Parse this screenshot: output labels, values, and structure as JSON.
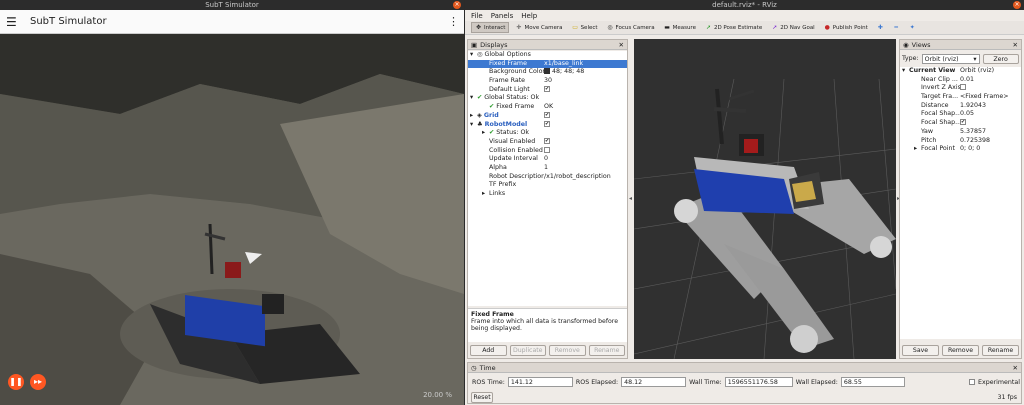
{
  "subt": {
    "titlebar": "SubT Simulator",
    "app_title": "SubT Simulator",
    "pause_icon": "pause-icon",
    "forward_icon": "fast-forward-icon",
    "overlay_text": "20.00 %"
  },
  "rviz": {
    "titlebar": "default.rviz* - RViz",
    "menu": [
      "File",
      "Panels",
      "Help"
    ],
    "tools": [
      {
        "label": "Interact",
        "icon": "hand-icon",
        "active": true
      },
      {
        "label": "Move Camera",
        "icon": "move-camera-icon"
      },
      {
        "label": "Select",
        "icon": "select-icon"
      },
      {
        "label": "Focus Camera",
        "icon": "focus-camera-icon"
      },
      {
        "label": "Measure",
        "icon": "measure-icon"
      },
      {
        "label": "2D Pose Estimate",
        "icon": "pose-estimate-icon"
      },
      {
        "label": "2D Nav Goal",
        "icon": "nav-goal-icon"
      },
      {
        "label": "Publish Point",
        "icon": "publish-point-icon"
      }
    ],
    "displays": {
      "title": "Displays",
      "rows": [
        {
          "key": "Global Options",
          "value": "",
          "indent": 1,
          "expander": "▾",
          "icon": "◎"
        },
        {
          "key": "Fixed Frame",
          "value": "x1/base_link",
          "indent": 2,
          "selected": true
        },
        {
          "key": "Background Color",
          "value": "48; 48; 48",
          "indent": 2,
          "swatch": true
        },
        {
          "key": "Frame Rate",
          "value": "30",
          "indent": 2
        },
        {
          "key": "Default Light",
          "value": "",
          "indent": 2,
          "check": true
        },
        {
          "key": "Global Status: Ok",
          "value": "",
          "indent": 1,
          "expander": "▾",
          "icon": "✔"
        },
        {
          "key": "Fixed Frame",
          "value": "OK",
          "indent": 2,
          "icon": "✔"
        },
        {
          "key": "Grid",
          "value": "",
          "indent": 1,
          "expander": "▸",
          "icon": "◈",
          "blue": true,
          "check": true
        },
        {
          "key": "RobotModel",
          "value": "",
          "indent": 1,
          "expander": "▾",
          "icon": "♣",
          "blue": true,
          "check": true
        },
        {
          "key": "Status: Ok",
          "value": "",
          "indent": 2,
          "expander": "▸",
          "icon": "✔"
        },
        {
          "key": "Visual Enabled",
          "value": "",
          "indent": 2,
          "check": true
        },
        {
          "key": "Collision Enabled",
          "value": "",
          "indent": 2,
          "check": false
        },
        {
          "key": "Update Interval",
          "value": "0",
          "indent": 2
        },
        {
          "key": "Alpha",
          "value": "1",
          "indent": 2
        },
        {
          "key": "Robot Description",
          "value": "/x1/robot_description",
          "indent": 2
        },
        {
          "key": "TF Prefix",
          "value": "",
          "indent": 2
        },
        {
          "key": "Links",
          "value": "",
          "indent": 2,
          "expander": "▸"
        }
      ],
      "desc_title": "Fixed Frame",
      "desc_text": "Frame into which all data is transformed before being displayed.",
      "buttons": [
        "Add",
        "Duplicate",
        "Remove",
        "Rename"
      ]
    },
    "views": {
      "title": "Views",
      "type_label": "Type:",
      "type_value": "Orbit (rviz)",
      "zero": "Zero",
      "rows": [
        {
          "key": "Current View",
          "value": "Orbit (rviz)",
          "expander": "▾",
          "bold": true,
          "indent": 1
        },
        {
          "key": "Near Clip ...",
          "value": "0.01",
          "indent": 2
        },
        {
          "key": "Invert Z Axis",
          "value": "",
          "indent": 2,
          "check": false
        },
        {
          "key": "Target Fra...",
          "value": "<Fixed Frame>",
          "indent": 2
        },
        {
          "key": "Distance",
          "value": "1.92043",
          "indent": 2
        },
        {
          "key": "Focal Shap...",
          "value": "0.05",
          "indent": 2
        },
        {
          "key": "Focal Shap...",
          "value": "",
          "indent": 2,
          "check": true
        },
        {
          "key": "Yaw",
          "value": "5.37857",
          "indent": 2
        },
        {
          "key": "Pitch",
          "value": "0.725398",
          "indent": 2
        },
        {
          "key": "Focal Point",
          "value": "0; 0; 0",
          "indent": 2,
          "expander": "▸"
        }
      ],
      "buttons": [
        "Save",
        "Remove",
        "Rename"
      ]
    },
    "time": {
      "title": "Time",
      "ros_time_label": "ROS Time:",
      "ros_time": "141.12",
      "ros_elapsed_label": "ROS Elapsed:",
      "ros_elapsed": "48.12",
      "wall_time_label": "Wall Time:",
      "wall_time": "1596551176.58",
      "wall_elapsed_label": "Wall Elapsed:",
      "wall_elapsed": "68.55",
      "experimental": "Experimental",
      "reset": "Reset",
      "fps": "31 fps"
    }
  }
}
